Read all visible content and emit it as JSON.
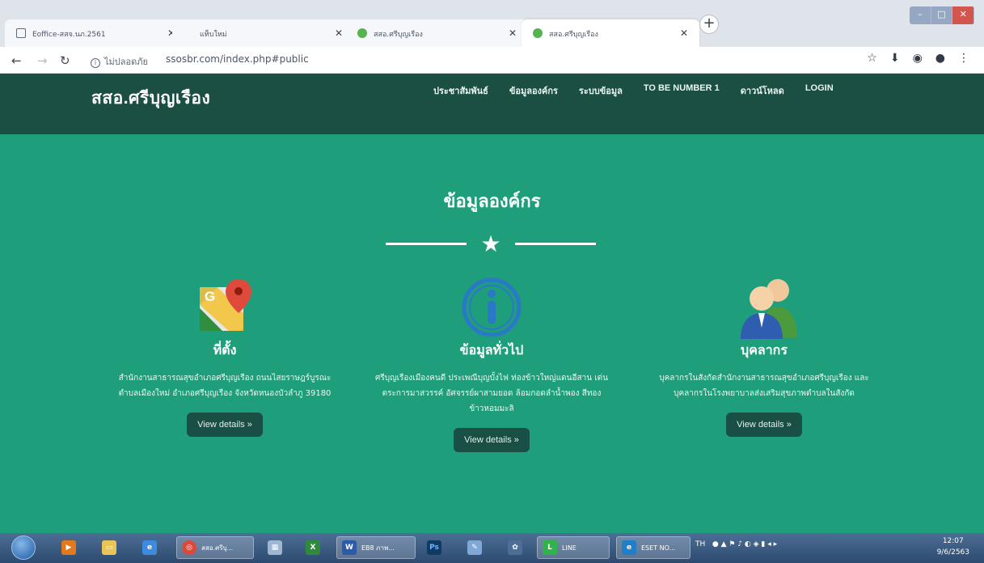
{
  "browser": {
    "tabs": [
      {
        "title": "Eoffice-สสจ.นภ.2561",
        "active": false,
        "icon": "document-icon"
      },
      {
        "title": "แท็บใหม่",
        "active": false,
        "icon": "blank"
      },
      {
        "title": "สสอ.ศรีบุญเรือง",
        "active": false,
        "icon": "site-favicon"
      },
      {
        "title": "สสอ.ศรีบุญเรือง",
        "active": true,
        "icon": "site-favicon"
      }
    ],
    "security_label": "ไม่ปลอดภัย",
    "url": "ssosbr.com/index.php#public"
  },
  "site": {
    "brand": "สสอ.ศรีบุญเรือง",
    "nav": [
      "ประชาสัมพันธ์",
      "ข้อมูลองค์กร",
      "ระบบข้อมูล",
      "TO BE NUMBER 1",
      "ดาวน์โหลด",
      "LOGIN"
    ],
    "section_title": "ข้อมูลองค์กร",
    "cards": [
      {
        "title": "ที่ตั้ง",
        "text": "สำนักงานสาธารณสุขอำเภอศรีบุญเรือง ถนนไสยราษฎร์บูรณะ ตำบลเมืองใหม่ อำเภอศรีบุญเรือง จังหวัดหนองบัวลำภู 39180",
        "button": "View details »",
        "icon": "google-maps-icon"
      },
      {
        "title": "ข้อมูลทั่วไป",
        "text": "ศรีบุญเรืองเมืองคนดี ประเพณีบุญบั้งไฟ ท่องข้าวใหญ่แดนอีสาน เด่นตระการมาสวรรค์ อัศจรรย์ผาสามยอด ล้อมกอดลำน้ำพอง สีทองข้าวหอมมะลิ",
        "button": "View details »",
        "icon": "info-icon"
      },
      {
        "title": "บุคลากร",
        "text": "บุคลากรในสังกัดสำนักงานสาธารณสุขอำเภอศรีบุญเรือง และ บุคลากรในโรงพยาบาลส่งเสริมสุขภาพตำบลในสังกัด",
        "button": "View details »",
        "icon": "people-icon"
      }
    ]
  },
  "taskbar": {
    "items": [
      {
        "label": "",
        "icon": "media-icon"
      },
      {
        "label": "",
        "icon": "explorer-icon"
      },
      {
        "label": "",
        "icon": "ie-icon"
      },
      {
        "label": "สสอ.ศรีบุ...",
        "icon": "chrome-icon"
      },
      {
        "label": "",
        "icon": "calculator-icon"
      },
      {
        "label": "",
        "icon": "excel-icon"
      },
      {
        "label": "EB8 ภาพ...",
        "icon": "word-icon"
      },
      {
        "label": "",
        "icon": "photoshop-icon"
      },
      {
        "label": "",
        "icon": "paint-icon"
      },
      {
        "label": "",
        "icon": "settings-icon"
      },
      {
        "label": "LINE",
        "icon": "line-icon"
      },
      {
        "label": "ESET NO...",
        "icon": "eset-icon"
      }
    ],
    "language": "TH",
    "time": "12:07",
    "date": "9/6/2563"
  },
  "colors": {
    "page_green": "#1e9e7a",
    "header_dark": "#1b4f43",
    "button_dark": "#1a4f45",
    "taskbar": "#2d4a70"
  }
}
